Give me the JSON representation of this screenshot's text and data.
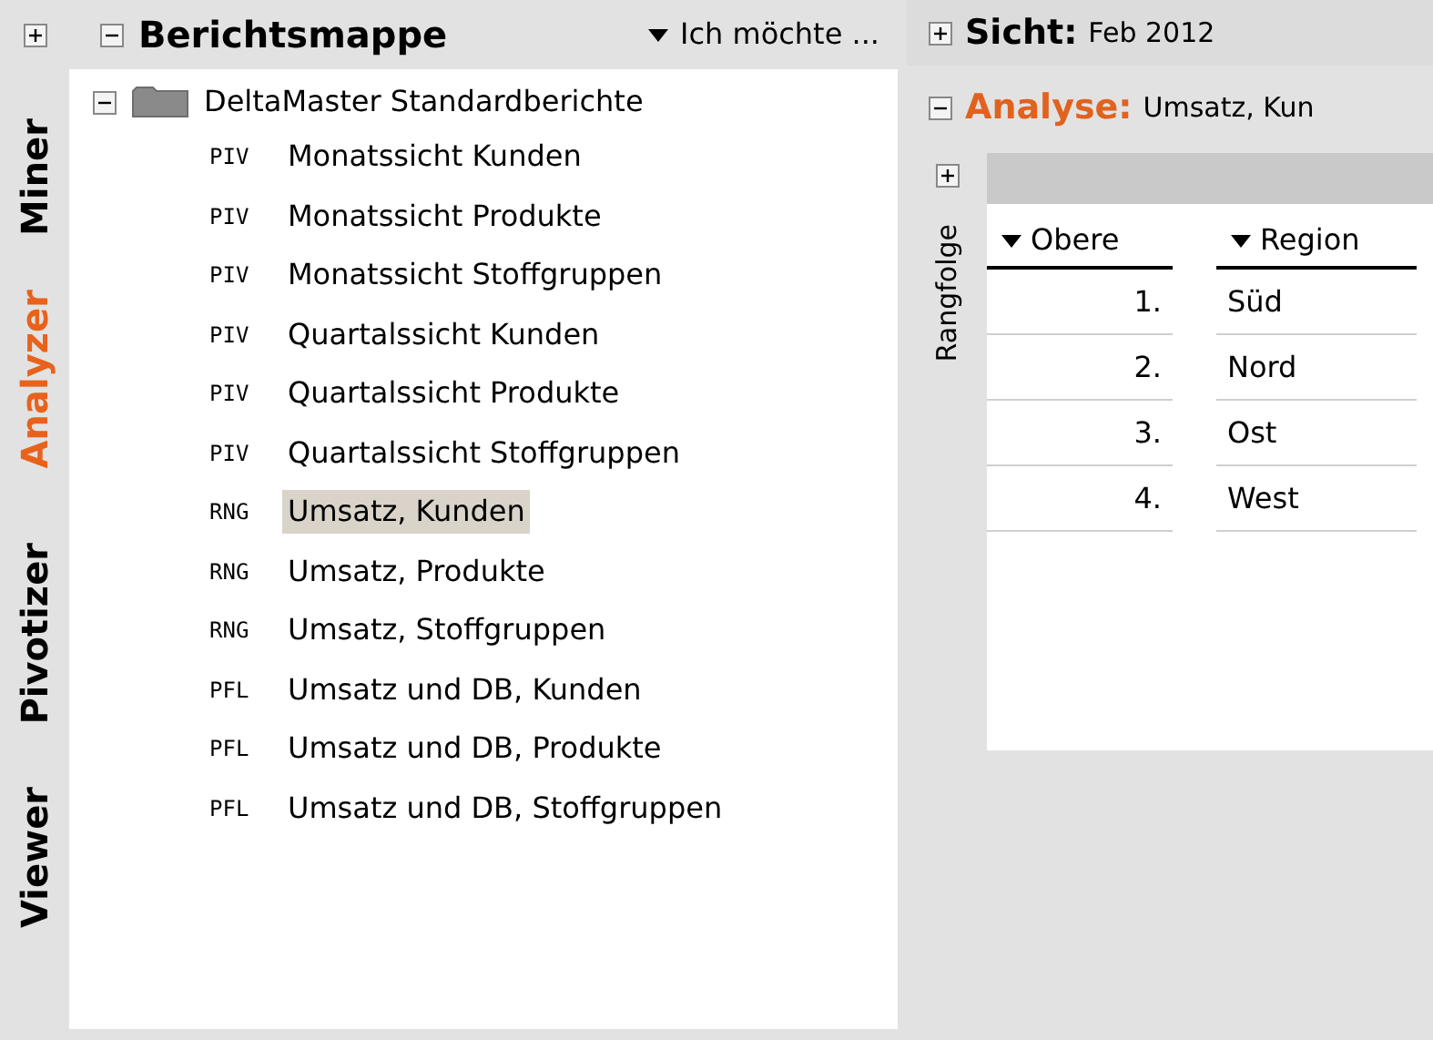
{
  "side_tabs": [
    {
      "label": "Miner",
      "selected": false
    },
    {
      "label": "Analyzer",
      "selected": true
    },
    {
      "label": "Pivotizer",
      "selected": false
    },
    {
      "label": "Viewer",
      "selected": false
    }
  ],
  "left_panel": {
    "expanded": false
  },
  "report_folder": {
    "title": "Berichtsmappe",
    "expanded": true,
    "menu": "Ich möchte ..."
  },
  "tree": {
    "label": "DeltaMaster Standardberichte",
    "expanded": true,
    "children": [
      {
        "code": "PIV",
        "label": "Monatssicht Kunden",
        "selected": false
      },
      {
        "code": "PIV",
        "label": "Monatssicht Produkte",
        "selected": false
      },
      {
        "code": "PIV",
        "label": "Monatssicht Stoffgruppen",
        "selected": false
      },
      {
        "code": "PIV",
        "label": "Quartalssicht Kunden",
        "selected": false
      },
      {
        "code": "PIV",
        "label": "Quartalssicht Produkte",
        "selected": false
      },
      {
        "code": "PIV",
        "label": "Quartalssicht Stoffgruppen",
        "selected": false
      },
      {
        "code": "RNG",
        "label": "Umsatz, Kunden",
        "selected": true
      },
      {
        "code": "RNG",
        "label": "Umsatz, Produkte",
        "selected": false
      },
      {
        "code": "RNG",
        "label": "Umsatz, Stoffgruppen",
        "selected": false
      },
      {
        "code": "PFL",
        "label": "Umsatz und DB, Kunden",
        "selected": false
      },
      {
        "code": "PFL",
        "label": "Umsatz und DB, Produkte",
        "selected": false
      },
      {
        "code": "PFL",
        "label": "Umsatz und DB, Stoffgruppen",
        "selected": false
      }
    ]
  },
  "view": {
    "label": "Sicht:",
    "value": "Feb 2012",
    "expanded": false
  },
  "analysis": {
    "label": "Analyse:",
    "value": "Umsatz, Kun",
    "expanded": true
  },
  "filter_bar": {
    "expanded": false
  },
  "ranking": {
    "label": "Rangfolge",
    "columns": [
      "Obere",
      "Region"
    ],
    "rows": [
      [
        "1.",
        "Süd"
      ],
      [
        "2.",
        "Nord"
      ],
      [
        "3.",
        "Ost"
      ],
      [
        "4.",
        "West"
      ]
    ]
  }
}
